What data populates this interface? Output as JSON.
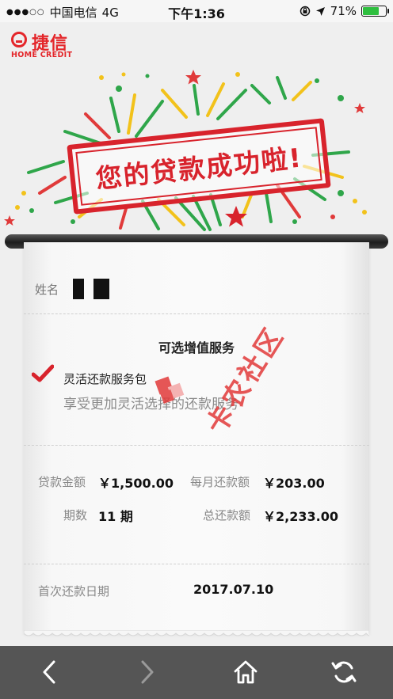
{
  "status_bar": {
    "signal": "●●●○○",
    "carrier": "中国电信",
    "network": "4G",
    "time": "下午1:36",
    "battery_percent": "71%",
    "battery_level": 0.71,
    "battery_color": "#2fbf3f"
  },
  "brand": {
    "name_cn": "捷信",
    "name_en": "HOME CREDIT",
    "color": "#e4262a"
  },
  "banner": {
    "stamp_text": "您的贷款成功啦!"
  },
  "receipt": {
    "name_label": "姓名",
    "section_title": "可选增值服务",
    "option": {
      "checked": true,
      "title": "灵活还款服务包",
      "description": "享受更加灵活选择的还款服务"
    },
    "fields": {
      "loan_amount": {
        "label": "贷款金额",
        "value": "￥1,500.00"
      },
      "monthly_payment": {
        "label": "每月还款额",
        "value": "￥203.00"
      },
      "periods": {
        "label": "期数",
        "value": "11 期"
      },
      "total_repayment": {
        "label": "总还款额",
        "value": "￥2,233.00"
      },
      "first_payment_date": {
        "label": "首次还款日期",
        "value": "2017.07.10"
      }
    }
  },
  "watermark": {
    "text": "卡农社区"
  },
  "toolbar": {
    "icons": [
      "back-icon",
      "forward-icon",
      "home-icon",
      "refresh-icon"
    ]
  }
}
